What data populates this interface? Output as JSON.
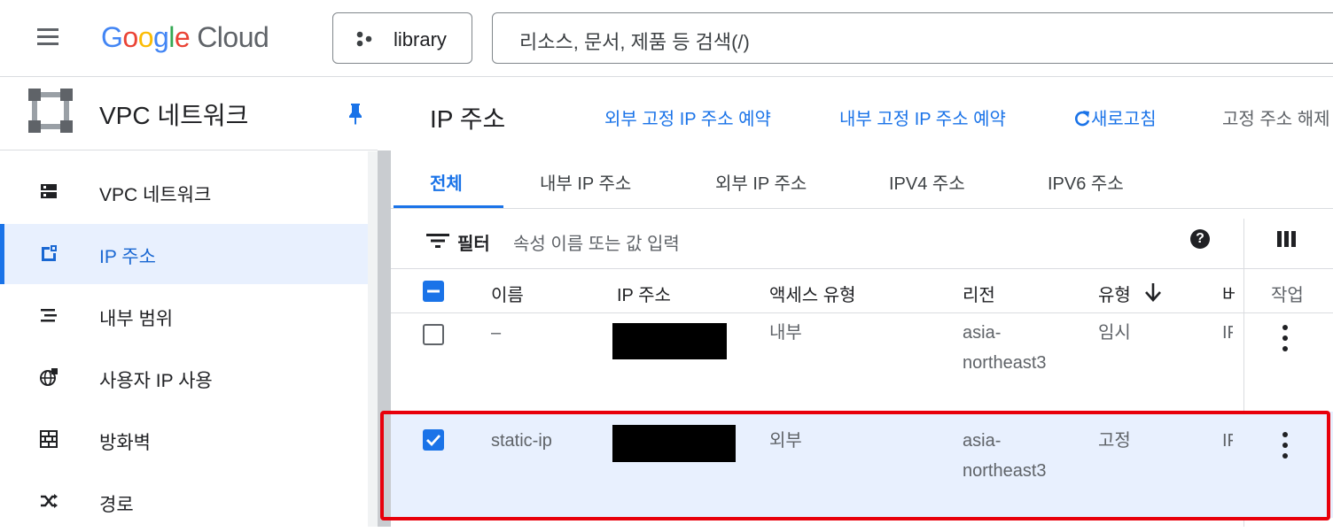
{
  "header": {
    "logo_letters": [
      "G",
      "o",
      "o",
      "g",
      "l",
      "e"
    ],
    "logo_cloud": "Cloud",
    "project": "library",
    "search_placeholder": "리소스, 문서, 제품 등 검색(/)"
  },
  "sidebar": {
    "title": "VPC 네트워크",
    "items": [
      {
        "label": "VPC 네트워크",
        "icon": "vpc-network-icon"
      },
      {
        "label": "IP 주소",
        "icon": "ip-address-icon",
        "active": true
      },
      {
        "label": "내부 범위",
        "icon": "internal-range-icon"
      },
      {
        "label": "사용자 IP 사용",
        "icon": "byoip-globe-icon"
      },
      {
        "label": "방화벽",
        "icon": "firewall-icon"
      },
      {
        "label": "경로",
        "icon": "routes-icon"
      }
    ]
  },
  "main": {
    "title": "IP 주소",
    "actions": {
      "reserve_external": "외부 고정 IP 주소 예약",
      "reserve_internal": "내부 고정 IP 주소 예약",
      "refresh": "새로고침",
      "release": "고정 주소 해제"
    },
    "tabs": [
      "전체",
      "내부 IP 주소",
      "외부 IP 주소",
      "IPV4 주소",
      "IPV6 주소"
    ],
    "filter": {
      "label": "필터",
      "placeholder": "속성 이름 또는 값 입력"
    },
    "columns": {
      "name": "이름",
      "ip": "IP 주소",
      "access": "액세스 유형",
      "region": "리전",
      "type": "유형",
      "version_cut": "버",
      "actions": "작업"
    },
    "rows": [
      {
        "checked": false,
        "name": "–",
        "access": "내부",
        "region_l1": "asia-",
        "region_l2": "northeast3",
        "type": "임시",
        "version_cut": "IF"
      },
      {
        "checked": true,
        "name": "static-ip",
        "access": "외부",
        "region_l1": "asia-",
        "region_l2": "northeast3",
        "type": "고정",
        "version_cut": "IF"
      }
    ]
  },
  "colors": {
    "accent": "#1a73e8",
    "active_bg": "#e8f0fe",
    "selected_row_bg": "#e8f0fe",
    "highlight_border": "#e8000b"
  }
}
